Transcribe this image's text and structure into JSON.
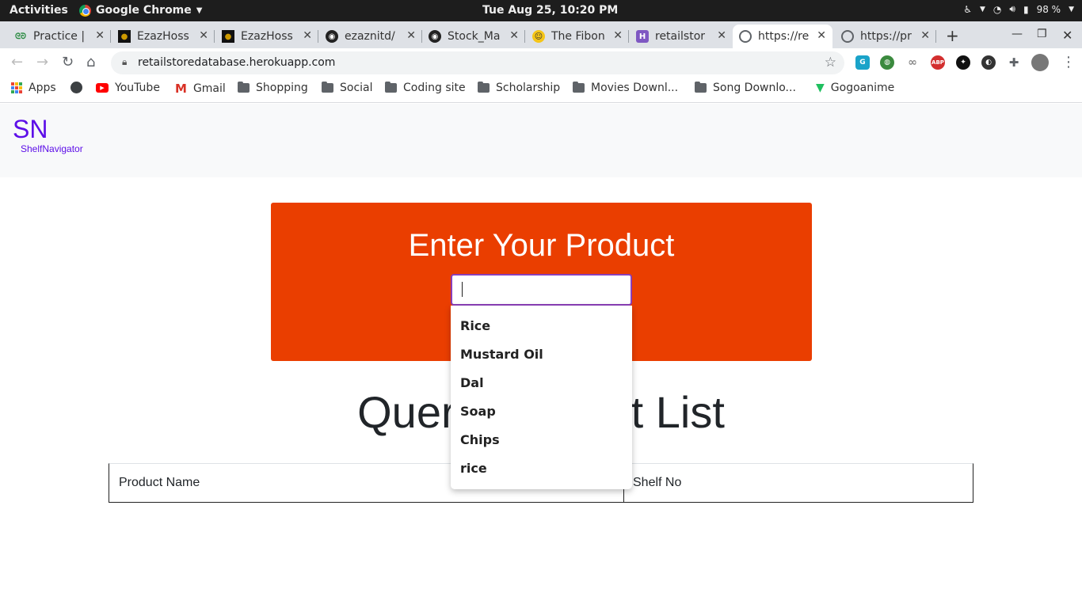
{
  "system": {
    "activities": "Activities",
    "app_name": "Google Chrome",
    "clock": "Tue Aug 25, 10:20 PM",
    "battery": "98 %"
  },
  "tabs": [
    {
      "title": "Practice |",
      "favicon": "gfg-icon"
    },
    {
      "title": "EzazHoss",
      "favicon": "dark-avatar-icon"
    },
    {
      "title": "EzazHoss",
      "favicon": "dark-avatar-icon"
    },
    {
      "title": "ezaznitd/",
      "favicon": "github-icon"
    },
    {
      "title": "Stock_Ma",
      "favicon": "github-icon"
    },
    {
      "title": "The Fibon",
      "favicon": "emoji-icon"
    },
    {
      "title": "retailstor",
      "favicon": "heroku-icon"
    },
    {
      "title": "https://re",
      "favicon": "globe-icon"
    },
    {
      "title": "https://pr",
      "favicon": "globe-icon"
    }
  ],
  "address": {
    "url": "retailstoredatabase.herokuapp.com"
  },
  "bookmarks": [
    {
      "label": "Apps",
      "icon": "apps-grid-icon"
    },
    {
      "label": "",
      "icon": "globe-icon"
    },
    {
      "label": "YouTube",
      "icon": "youtube-icon"
    },
    {
      "label": "Gmail",
      "icon": "gmail-icon"
    },
    {
      "label": "Shopping",
      "icon": "folder-icon"
    },
    {
      "label": "Social",
      "icon": "folder-icon"
    },
    {
      "label": "Coding site",
      "icon": "folder-icon"
    },
    {
      "label": "Scholarship",
      "icon": "folder-icon"
    },
    {
      "label": "Movies Downl...",
      "icon": "folder-icon"
    },
    {
      "label": "Song Downlo...",
      "icon": "folder-icon"
    },
    {
      "label": "Gogoanime",
      "icon": "gogoanime-icon"
    }
  ],
  "page": {
    "brand_short": "SN",
    "brand_full": "ShelfNavigator",
    "hero_title": "Enter Your Product",
    "search_value": "",
    "query_title": "Query Product List",
    "table_headers": [
      "Product Name",
      "Shelf No"
    ],
    "suggestions": [
      "Rice",
      "Mustard Oil",
      "Dal",
      "Soap",
      "Chips",
      "rice"
    ]
  },
  "colors": {
    "hero_bg": "#ea3e00",
    "brand": "#5d0fe8",
    "search_border": "#8a3fb8"
  }
}
